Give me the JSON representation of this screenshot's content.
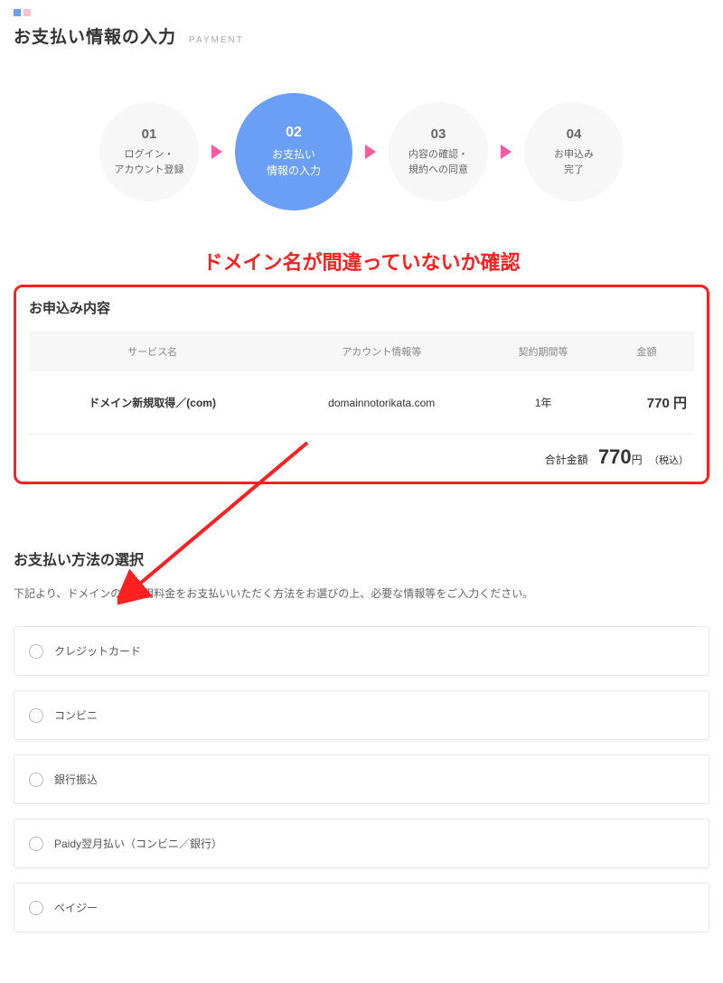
{
  "header": {
    "title": "お支払い情報の入力",
    "title_en": "PAYMENT"
  },
  "steps": [
    {
      "num": "01",
      "label": "ログイン・\nアカウント登録",
      "active": false
    },
    {
      "num": "02",
      "label": "お支払い\n情報の入力",
      "active": true
    },
    {
      "num": "03",
      "label": "内容の確認・\n規約への同意",
      "active": false
    },
    {
      "num": "04",
      "label": "お申込み\n完了",
      "active": false
    }
  ],
  "annotation": "ドメイン名が間違っていないか確認",
  "order": {
    "title": "お申込み内容",
    "columns": [
      "サービス名",
      "アカウント情報等",
      "契約期間等",
      "金額"
    ],
    "rows": [
      {
        "service": "ドメイン新規取得／(com)",
        "account": "domainnotorikata.com",
        "period": "1年",
        "amount": "770 円"
      }
    ],
    "total_label": "合計金額",
    "total_amount": "770",
    "total_unit": "円",
    "total_tax": "（税込）"
  },
  "payment": {
    "title": "お支払い方法の選択",
    "desc": "下記より、ドメインのご利用料金をお支払いいただく方法をお選びの上、必要な情報等をご入力ください。",
    "options": [
      "クレジットカード",
      "コンビニ",
      "銀行振込",
      "Paidy翌月払い（コンビニ／銀行）",
      "ペイジー"
    ]
  }
}
